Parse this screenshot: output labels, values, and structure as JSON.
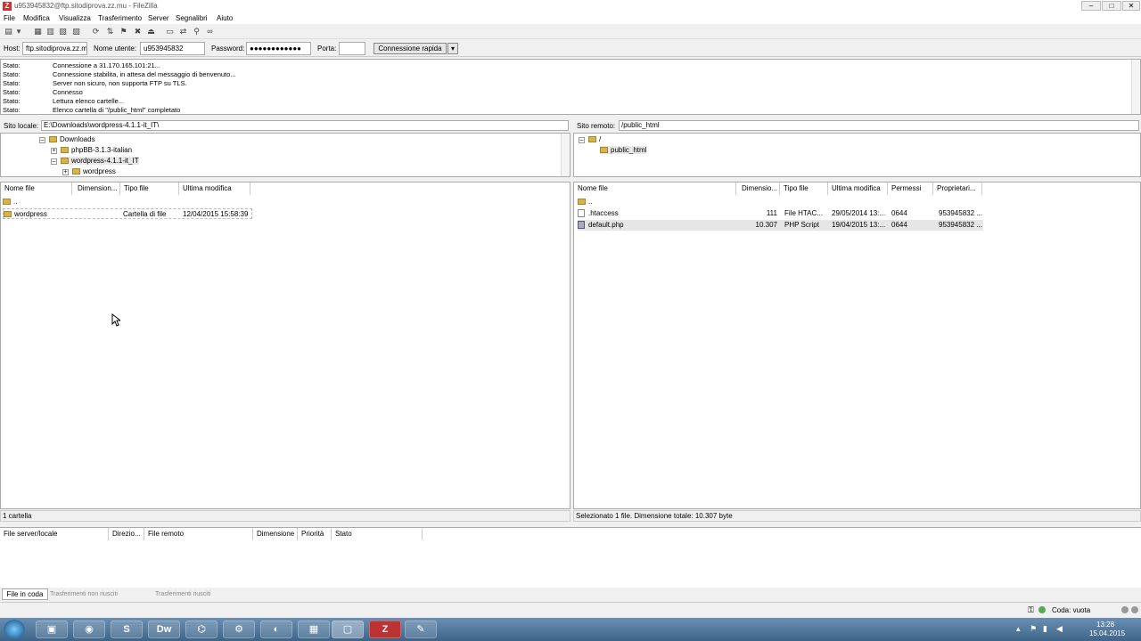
{
  "window": {
    "title": "u953945832@ftp.sitodiprova.zz.mu - FileZilla",
    "app_icon": "filezilla-icon"
  },
  "menu": [
    "File",
    "Modifica",
    "Visualizza",
    "Trasferimento",
    "Server",
    "Segnalibri",
    "Aiuto"
  ],
  "quickconnect": {
    "host_label": "Host:",
    "host_value": "ftp.sitodiprova.zz.m",
    "user_label": "Nome utente:",
    "user_value": "u953945832",
    "password_label": "Password:",
    "password_value": "●●●●●●●●●●●●",
    "port_label": "Porta:",
    "port_value": "",
    "connect_label": "Connessione rapida"
  },
  "log": [
    {
      "key": "Stato:",
      "value": "Connessione a 31.170.165.101:21..."
    },
    {
      "key": "Stato:",
      "value": "Connessione stabilita, in attesa del messaggio di benvenuto..."
    },
    {
      "key": "Stato:",
      "value": "Server non sicuro, non supporta FTP su TLS."
    },
    {
      "key": "Stato:",
      "value": "Connesso"
    },
    {
      "key": "Stato:",
      "value": "Lettura elenco cartelle..."
    },
    {
      "key": "Stato:",
      "value": "Elenco cartella di \"/public_html\" completato"
    }
  ],
  "local": {
    "site_label": "Sito locale:",
    "site_path": "E:\\Downloads\\wordpress-4.1.1-it_IT\\",
    "tree": [
      "Downloads",
      "phpBB-3.1.3-italian",
      "wordpress-4.1.1-it_IT",
      "wordpress"
    ],
    "columns": [
      "Nome file",
      "Dimension...",
      "Tipo file",
      "Ultima modifica"
    ],
    "rows": [
      {
        "name": "..",
        "size": "",
        "type": "",
        "modified": ""
      },
      {
        "name": "wordpress",
        "size": "",
        "type": "Cartella di file",
        "modified": "12/04/2015 15:58:39"
      }
    ],
    "status": "1 cartella"
  },
  "remote": {
    "site_label": "Sito remoto:",
    "site_path": "/public_html",
    "tree": [
      "/",
      "public_html"
    ],
    "columns": [
      "Nome file",
      "Dimensio...",
      "Tipo file",
      "Ultima modifica",
      "Permessi",
      "Proprietari..."
    ],
    "rows": [
      {
        "name": "..",
        "size": "",
        "type": "",
        "modified": "",
        "perms": "",
        "owner": ""
      },
      {
        "name": ".htaccess",
        "size": "111",
        "type": "File HTAC...",
        "modified": "29/05/2014 13:...",
        "perms": "0644",
        "owner": "953945832 ..."
      },
      {
        "name": "default.php",
        "size": "10.307",
        "type": "PHP Script",
        "modified": "19/04/2015 13:...",
        "perms": "0644",
        "owner": "953945832 ..."
      }
    ],
    "status": "Selezionato 1 file. Dimensione totale: 10.307 byte"
  },
  "queue": {
    "columns": [
      "File server/locale",
      "Direzio...",
      "File remoto",
      "Dimensione",
      "Priorità",
      "Stato"
    ],
    "tabs": [
      "File in coda",
      "Trasferimenti non riusciti",
      "Trasferimenti riusciti"
    ]
  },
  "statusbar": {
    "queue_text": "Coda: vuota"
  },
  "taskbar": {
    "time": "13:28",
    "date": "15.04.2015"
  }
}
